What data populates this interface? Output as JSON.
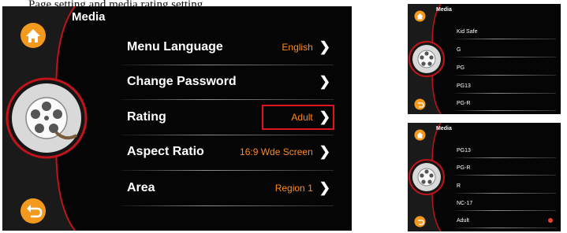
{
  "caption": "Page setting and media rating setting",
  "main": {
    "title": "Media",
    "rows": [
      {
        "label": "Menu Language",
        "value": "English"
      },
      {
        "label": "Change Password",
        "value": ""
      },
      {
        "label": "Rating",
        "value": "Adult"
      },
      {
        "label": "Aspect Ratio",
        "value": "16:9 Wde Screen"
      },
      {
        "label": "Area",
        "value": "Region 1"
      }
    ],
    "highlighted_row": "Rating"
  },
  "small1": {
    "title": "Media",
    "items": [
      "Kid Safe",
      "G",
      "PG",
      "PG13",
      "PG-R"
    ]
  },
  "small2": {
    "title": "Media",
    "items": [
      "PG13",
      "PG-R",
      "R",
      "NC-17",
      "Adult"
    ],
    "selected": "Adult"
  },
  "icons": [
    "home-icon",
    "back-icon",
    "film-reel-icon",
    "chevron-right-icon",
    "selected-dot-icon"
  ],
  "colors": {
    "accent_orange": "#ff8a1c",
    "accent_red": "#e0141d",
    "background": "#050505",
    "home_button": "#f39a1e"
  }
}
